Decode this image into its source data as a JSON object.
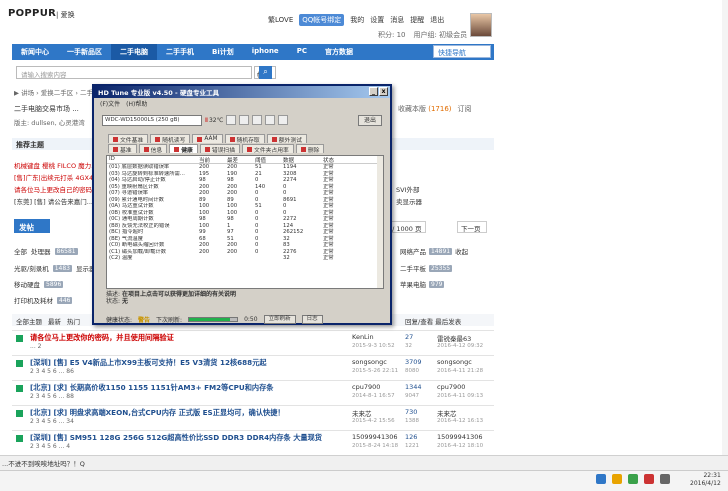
{
  "header": {
    "brand": "POPPUR",
    "brand_sub": "| 爱换",
    "user": "繁LOVE",
    "qq_btn": "QQ帐号绑定",
    "links": [
      "我的",
      "设置",
      "消息",
      "提醒",
      "退出"
    ],
    "sub": [
      "积分: 10",
      "用户组: 初级会员"
    ]
  },
  "nav": {
    "items": [
      "新闻中心",
      "一手新品区",
      "二手电脑",
      "二手手机",
      "Bi计划",
      "iphone",
      "PC",
      "官方数据"
    ],
    "active": 2,
    "quick": "快捷导航"
  },
  "search": {
    "placeholder": "请输入搜索内容",
    "type": "帖子"
  },
  "breadcrumb": "▶ 讲场 › 爱换二手区 › 二手电",
  "forum": {
    "title": "二手电脑交易市场 ...",
    "mods": "版主: dullsen, 心灵港湾",
    "fav_label": "收藏本版",
    "fav_count": "(1716)",
    "rss": "订阅"
  },
  "pinned": {
    "header": "推荐主题",
    "lines": [
      "机械键盘 樱桃 FILCO 魔力...",
      "[售]广东|出续元打杀 4GX4...",
      "请各位马上更改自己的密码...",
      "[东莞] [售] 请公告来嘉门..."
    ],
    "tail_right": "SVI外部",
    "tail_right2": "卖显示器"
  },
  "post_btn": "发帖",
  "pager": {
    "pages": [
      "1",
      "2"
    ],
    "goto": "/ 1000 页",
    "next": "下一页"
  },
  "cats": {
    "all": "全部",
    "rows": [
      [
        "处理器",
        "86581"
      ],
      [
        "光驱/刻录机",
        "1483"
      ],
      [
        "显示器",
        "1476"
      ],
      [
        "移动硬盘",
        "5896"
      ],
      [
        "打印机及耗材",
        "446"
      ]
    ],
    "right": [
      [
        "网络产品",
        "14891"
      ],
      [
        "二手平板",
        "25355"
      ],
      [
        "苹果电脑",
        "979"
      ]
    ],
    "side": "收起"
  },
  "filter": {
    "items": [
      "全部主题",
      "最新",
      "热门"
    ],
    "cols": "回复/查看  最后发表"
  },
  "threads": [
    {
      "title": "请各位马上更改你的密码，并且使用间隔验证",
      "pages": "... 2",
      "author": "KenLin",
      "date": "2015-9-3 10:52",
      "replies": "27",
      "views": "32",
      "last": "雷锐秦最63",
      "lastd": "2016-4-12 09:32",
      "red": true
    },
    {
      "title": "[深圳] [售] E5 V4新品上市X99主板可支持！E5 V3清货 12核688元起",
      "pages": "2 3 4 5 6 ... 86",
      "author": "songsongc",
      "date": "2015-5-26 22:11",
      "replies": "3709",
      "views": "8080",
      "last": "songsongc",
      "lastd": "2016-4-11 21:28",
      "red": false
    },
    {
      "title": "[北京] [求] 长期高价收1150 1155 1151针AM3+ FM2等CPU和内存条",
      "pages": "2 3 4 5 6 ... 88",
      "author": "cpu7900",
      "date": "2014-8-1 16:57",
      "replies": "1344",
      "views": "9047",
      "last": "cpu7900",
      "lastd": "2016-4-11 09:13",
      "red": false
    },
    {
      "title": "[北京] [求] 明盘求高端XEON,台式CPU内存 正式版 ES正显均可，确认快捷！",
      "pages": "2 3 4 5 6 ... 34",
      "author": "未来芯",
      "date": "2015-4-2 15:56",
      "replies": "730",
      "views": "1388",
      "last": "未来芯",
      "lastd": "2016-4-12 16:13",
      "red": false
    },
    {
      "title": "[深圳] [售] SM951 128G 256G 512G超高性价比SSD DDR3 DDR4内存条 大量现货",
      "pages": "2 3 4 5 6 ... 4",
      "author": "15099941306",
      "date": "2015-8-24 14:18",
      "replies": "126",
      "views": "1221",
      "last": "15099941306",
      "lastd": "2016-4-12 18:10",
      "red": false
    }
  ],
  "statusline": "...不进不到唉唉地址吗？！Q",
  "clock": {
    "time": "22:31",
    "date": "2016/4/12"
  },
  "hdtune": {
    "title": "HD Tune 专业版 v4.50 - 硬盘专业工具",
    "menu": [
      "(F)文件",
      "(H)帮助"
    ],
    "drive": "WDC-WD15000LS (250 gB)",
    "temp": "32℃",
    "exit": "退出",
    "tabs1": [
      "文件基准",
      "随机读写",
      "AAM",
      "随机存取",
      "额外测试"
    ],
    "tabs2": [
      "基准",
      "信息",
      "健康",
      "错误扫描",
      "文件夹占用率",
      "删除"
    ],
    "active_tab": "健康",
    "headers": [
      "ID",
      "当前",
      "最差",
      "阈值",
      "数据",
      "状态"
    ],
    "rows": [
      [
        "(01) 底层数据读取错误率",
        "200",
        "200",
        "51",
        "1194",
        "正常"
      ],
      [
        "(03) 马达旋转到标准转速所需...",
        "195",
        "190",
        "21",
        "3208",
        "正常"
      ],
      [
        "(04) 马达启动/停止计数",
        "98",
        "98",
        "0",
        "2274",
        "正常"
      ],
      [
        "(05) 重映射扇区计数",
        "200",
        "200",
        "140",
        "0",
        "正常"
      ],
      [
        "(07) 寻道错误率",
        "200",
        "200",
        "0",
        "0",
        "正常"
      ],
      [
        "(09) 累计通电时间计数",
        "89",
        "89",
        "0",
        "8691",
        "正常"
      ],
      [
        "(0A) 马达重试计数",
        "100",
        "100",
        "51",
        "0",
        "正常"
      ],
      [
        "(0B) 校准重试计数",
        "100",
        "100",
        "0",
        "0",
        "正常"
      ],
      [
        "(0C) 通电周期计数",
        "98",
        "98",
        "0",
        "2272",
        "正常"
      ],
      [
        "(B8) 反馈无法校正的错误",
        "100",
        "1",
        "0",
        "124",
        "正常"
      ],
      [
        "(BC) 指令超时",
        "99",
        "97",
        "0",
        "262152",
        "正常"
      ],
      [
        "(BE) 气流温度",
        "68",
        "51",
        "0",
        "32",
        "正常"
      ],
      [
        "(C0) 断电磁头缩回计数",
        "200",
        "200",
        "0",
        "83",
        "正常"
      ],
      [
        "(C1) 磁头加载/卸载计数",
        "200",
        "200",
        "0",
        "2276",
        "正常"
      ],
      [
        "(C2) 温度",
        "",
        "",
        "",
        "32",
        "正常"
      ]
    ],
    "desc_label": "描述:",
    "desc": "在项目上点击可以获得更加详细的有关说明",
    "status_label": "状态:",
    "status_val": "无",
    "health_label": "健康状态:",
    "health": "警告",
    "next_label": "下次刷新:",
    "progress": 0.85,
    "countdown": "0:50",
    "refresh": "立即刷新",
    "log": "日志"
  }
}
